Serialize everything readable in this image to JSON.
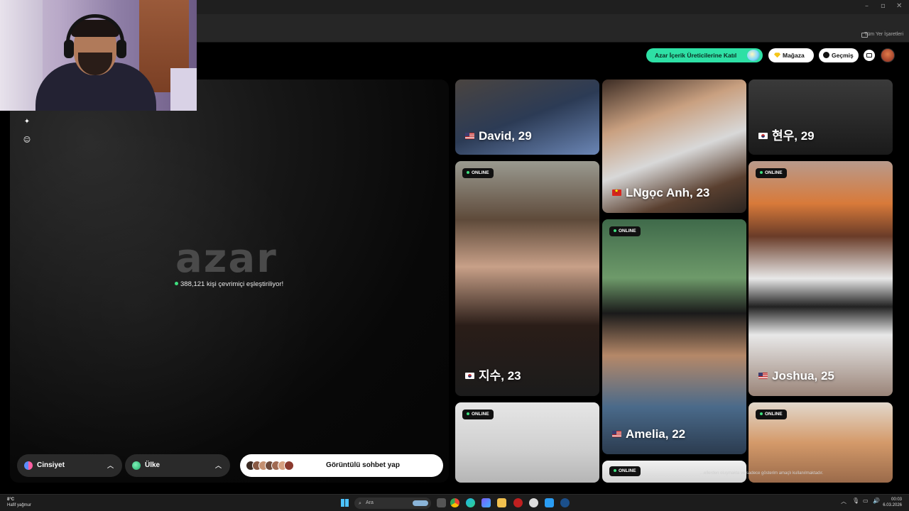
{
  "browser": {
    "bookmarks_label": "Tüm Yer İşaretleri",
    "window_controls": [
      "–",
      "▫",
      "✕"
    ]
  },
  "header": {
    "creator_button": "Azar İçerik Üreticilerine Katıl",
    "store_button": "Mağaza",
    "history_button": "Geçmiş"
  },
  "stage": {
    "logo": "azar",
    "online_text": "388,121 kişi çevrimiçi eşleştiriliyor!",
    "tools": [
      "magic-wand-icon",
      "face-filter-icon"
    ]
  },
  "controls": {
    "gender_label": "Cinsiyet",
    "country_label": "Ülke",
    "video_chat_label": "Görüntülü sohbet yap"
  },
  "cards": [
    {
      "name": "David, 29",
      "flag": "us",
      "online": false
    },
    {
      "name": "LNgọc Anh, 23",
      "flag": "vn",
      "online": false
    },
    {
      "name": "현우, 29",
      "flag": "kr",
      "online": false
    },
    {
      "name": "지수, 23",
      "flag": "kr",
      "online": true
    },
    {
      "name": "Amelia, 22",
      "flag": "us",
      "online": true
    },
    {
      "name": "Joshua, 25",
      "flag": "us",
      "online": true
    },
    {
      "name": "",
      "flag": "",
      "online": true
    },
    {
      "name": "",
      "flag": "",
      "online": true
    },
    {
      "name": "",
      "flag": "",
      "online": true
    }
  ],
  "online_badge": "ONLINE",
  "disclaimer": "...ellerden oluşmakta ve sadece gösterim amaçlı kullanılmaktadır.",
  "taskbar": {
    "weather_temp": "8°C",
    "weather_desc": "Hafif yağmur",
    "search_placeholder": "Ara",
    "time": "00:03",
    "date": "6.03.2026"
  },
  "colors": {
    "accent_green": "#2ee0a5",
    "online_dot": "#3ee07f"
  }
}
